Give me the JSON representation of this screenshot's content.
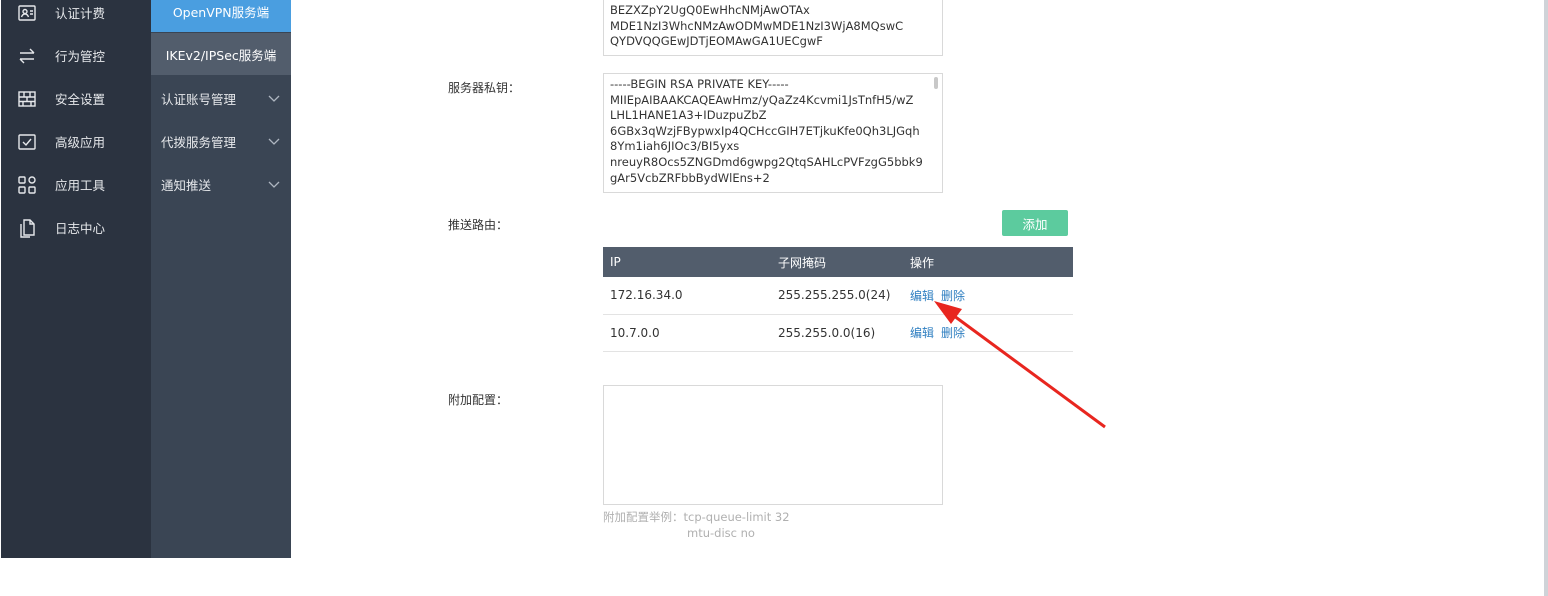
{
  "sidebar": {
    "items": [
      {
        "label": "认证计费",
        "icon": "user-card-icon"
      },
      {
        "label": "行为管控",
        "icon": "swap-arrows-icon"
      },
      {
        "label": "安全设置",
        "icon": "firewall-icon"
      },
      {
        "label": "高级应用",
        "icon": "checklist-icon"
      },
      {
        "label": "应用工具",
        "icon": "apps-grid-icon"
      },
      {
        "label": "日志中心",
        "icon": "document-icon"
      }
    ]
  },
  "subnav": {
    "openvpn": "OpenVPN服务端",
    "ikev2": "IKEv2/IPSec服务端",
    "groups": [
      "认证账号管理",
      "代拨服务管理",
      "通知推送"
    ]
  },
  "form": {
    "cert_text": "BEZXZpY2UgQ0EwHhcNMjAwOTAx\nMDE1NzI3WhcNMzAwODMwMDE1NzI3WjA8MQswC\nQYDVQQGEwJDTjEOMAwGA1UECgwF",
    "private_key_label": "服务器私钥：",
    "private_key_text": "-----BEGIN RSA PRIVATE KEY-----\nMIIEpAIBAAKCAQEAwHmz/yQaZz4Kcvmi1JsTnfH5/wZ\nLHL1HANE1A3+IDuzpuZbZ\n6GBx3qWzjFBypwxIp4QCHccGIH7ETjkuKfe0Qh3LJGqh\n8Ym1iah6JIOc3/BI5yxs\nnreuyR8Ocs5ZNGDmd6gwpg2QtqSAHLcPVFzgG5bbk9\ngAr5VcbZRFbbBydWlEns+2",
    "push_route_label": "推送路由：",
    "add_button": "添加",
    "extra_config_label": "附加配置：",
    "extra_config_value": "",
    "hint_line1": "附加配置举例：tcp-queue-limit 32",
    "hint_line2": "mtu-disc no"
  },
  "routes": {
    "headers": [
      "IP",
      "子网掩码",
      "操作"
    ],
    "rows": [
      {
        "ip": "172.16.34.0",
        "mask": "255.255.255.0(24)",
        "edit": "编辑",
        "delete": "删除"
      },
      {
        "ip": "10.7.0.0",
        "mask": "255.255.0.0(16)",
        "edit": "编辑",
        "delete": "删除"
      }
    ]
  },
  "colors": {
    "sidebar_bg": "#2b3340",
    "subnav_bg": "#3a4554",
    "active_blue": "#4a9ee0",
    "add_green": "#5ccb9e",
    "link_blue": "#2f7fc1",
    "annotation_red": "#e8261f"
  }
}
